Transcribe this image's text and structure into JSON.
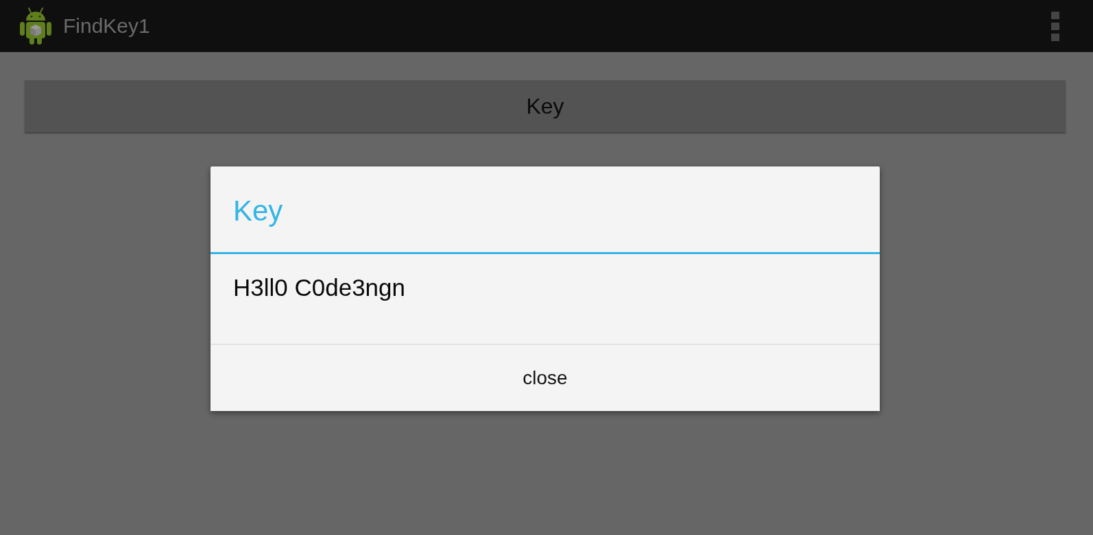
{
  "action_bar": {
    "title": "FindKey1"
  },
  "key_button": {
    "label": "Key"
  },
  "dialog": {
    "title": "Key",
    "message": "H3ll0 C0de3ngn",
    "buttons": [
      "close"
    ]
  }
}
